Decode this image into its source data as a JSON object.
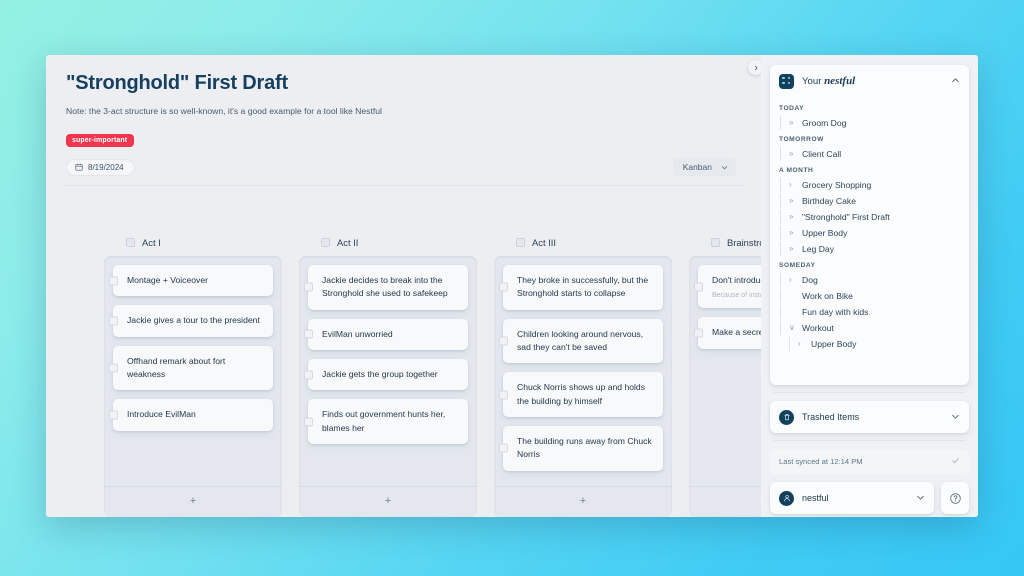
{
  "document": {
    "title": "\"Stronghold\" First Draft",
    "note": "Note: the 3-act structure is so well-known, it's a good example for a tool like Nestful",
    "tag": "super-important",
    "date": "8/19/2024",
    "view_mode": "Kanban"
  },
  "board": {
    "columns": [
      {
        "title": "Act I",
        "add_label": "+",
        "cards": [
          {
            "text": "Montage + Voiceover"
          },
          {
            "text": "Jackie gives a tour to the president"
          },
          {
            "text": "Offhand remark about fort weakness"
          },
          {
            "text": "Introduce EvilMan"
          }
        ]
      },
      {
        "title": "Act II",
        "add_label": "+",
        "cards": [
          {
            "text": "Jackie decides to break into the Stronghold she used to safekeep"
          },
          {
            "text": "EvilMan unworried"
          },
          {
            "text": "Jackie gets the group together"
          },
          {
            "text": "Finds out government hunts her, blames her"
          }
        ]
      },
      {
        "title": "Act III",
        "add_label": "+",
        "cards": [
          {
            "text": "They broke in successfully, but the Stronghold starts to collapse"
          },
          {
            "text": "Children looking around nervous, sad they can't be saved"
          },
          {
            "text": "Chuck Norris shows up and holds the building by himself"
          },
          {
            "text": "The building runs away from Chuck Norris"
          }
        ]
      },
      {
        "title": "Brainstrom",
        "add_label": "+",
        "cards": [
          {
            "text": "Don't introduce Chuck until the end",
            "sub": "Because of instant win"
          },
          {
            "text": "Make a secret under Stronghold"
          }
        ]
      }
    ]
  },
  "sidebar": {
    "brand_prefix": "Your",
    "brand_name": "nestful",
    "collapse_icon": "chevron-up",
    "sections": [
      {
        "label": "TODAY",
        "items": [
          {
            "label": "Groom Dog",
            "chevron": "»"
          }
        ]
      },
      {
        "label": "TOMORROW",
        "items": [
          {
            "label": "Client Call",
            "chevron": "»"
          }
        ]
      },
      {
        "label": "A MONTH",
        "items": [
          {
            "label": "Grocery Shopping",
            "chevron": "›"
          },
          {
            "label": "Birthday Cake",
            "chevron": "»"
          },
          {
            "label": "\"Stronghold\" First Draft",
            "chevron": "»"
          },
          {
            "label": "Upper Body",
            "chevron": "»"
          },
          {
            "label": "Leg Day",
            "chevron": "»"
          }
        ]
      },
      {
        "label": "SOMEDAY",
        "items": [
          {
            "label": "Dog",
            "chevron": "›"
          },
          {
            "label": "Work on Bike",
            "chevron": ""
          },
          {
            "label": "Fun day with kids",
            "chevron": ""
          },
          {
            "label": "Workout",
            "chevron": "∨"
          },
          {
            "label": "Upper Body",
            "chevron": "›",
            "indent": true
          }
        ]
      }
    ],
    "trash_label": "Trashed Items",
    "sync_text": "Last synced at 12:14 PM",
    "sync_icon": "check",
    "account_name": "nestful",
    "help_label": "?"
  },
  "colors": {
    "accent_tag": "#f0364f",
    "brand_dark": "#13415c",
    "bg_start": "#93f0e2",
    "bg_end": "#36c7f5"
  }
}
